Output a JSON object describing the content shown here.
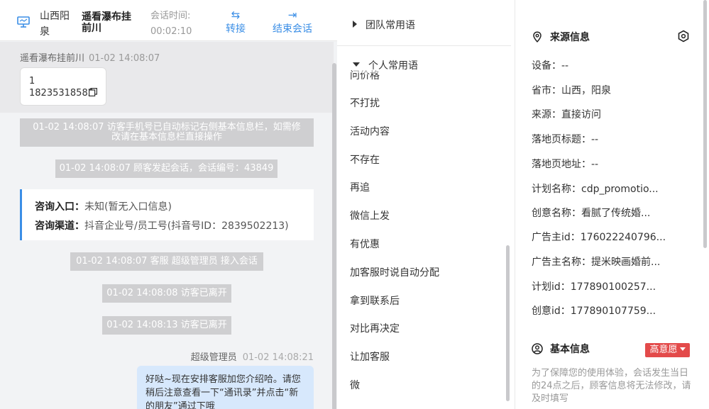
{
  "header": {
    "region": "山西阳泉",
    "visitor_name": "遥看瀑布挂前川",
    "time_label": "会话时间:",
    "time_value": "00:02:10",
    "transfer_label": "转接",
    "end_label": "结束会话",
    "accent_color": "#3a8ee6"
  },
  "chat": {
    "visitor_sender": "遥看瀑布挂前川",
    "visitor_time": "01-02 14:08:07",
    "visitor_message": "1 18235318582",
    "system_1": "01-02 14:08:07 访客手机号已自动标记右侧基本信息栏，如需修改请在基本信息栏直接操作",
    "system_2": "01-02 14:08:07 顾客发起会话，会话编号：43849",
    "entry_label": "咨询入口：",
    "entry_value": "未知(暂无入口信息)",
    "channel_label": "咨询渠道：",
    "channel_value": "抖音企业号/员工号(抖音号ID：2839502213)",
    "system_3": "01-02 14:08:07 客服 超级管理员 接入会话",
    "system_4": "01-02 14:08:08 访客已离开",
    "system_5": "01-02 14:08:13 访客已离开",
    "agent_sender": "超级管理员",
    "agent_time": "01-02 14:08:21",
    "agent_message": "好哒~现在安排客服加您介绍哈。请您稍后注意查看一下“通讯录”并点击“新的朋友”通过下哦"
  },
  "phrases": {
    "team_group": "团队常用语",
    "personal_group": "个人常用语",
    "items": [
      "问价格",
      "不打扰",
      "活动内容",
      "不存在",
      "再追",
      "微信上发",
      "有优惠",
      "加客服时说自动分配",
      "拿到联系后",
      "对比再决定",
      "让加客服",
      "微"
    ]
  },
  "source": {
    "title": "来源信息",
    "fields": [
      "设备：--",
      "省市：山西，阳泉",
      "来源：直接访问",
      "落地页标题：--",
      "落地页地址：--",
      "计划名称：cdp_promotio...",
      "创意名称：看腻了传统婚...",
      "广告主id：176022240796...",
      "广告主名称：提米映画婚前...",
      "计划id：177890100257...",
      "创意id：177890107759..."
    ]
  },
  "basic": {
    "title": "基本信息",
    "intent_badge": "高意愿",
    "badge_color": "#e34a4a",
    "notice": "为了保障您的使用体验，会话发生当日的24点之后，顾客信息将无法修改，请及时填写"
  }
}
